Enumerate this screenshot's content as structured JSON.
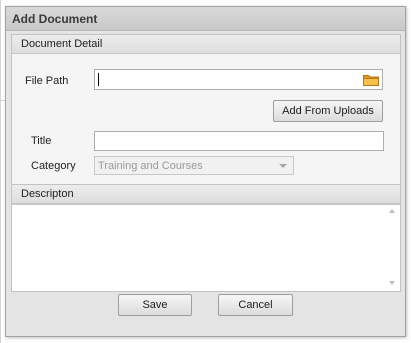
{
  "dialog": {
    "title": "Add Document"
  },
  "detail": {
    "header": "Document Detail",
    "file_path_label": "File Path",
    "file_path_value": "",
    "add_from_uploads_label": "Add From Uploads",
    "title_label": "Title",
    "title_value": "",
    "category_label": "Category",
    "category_value": "Training and Courses"
  },
  "description": {
    "header": "Descripton",
    "value": ""
  },
  "footer": {
    "save_label": "Save",
    "cancel_label": "Cancel"
  },
  "icons": {
    "folder": "folder-icon",
    "dropdown": "chevron-down-icon",
    "scroll_up": "scroll-up-icon",
    "scroll_down": "scroll-down-icon"
  },
  "colors": {
    "folder": "#f0a830",
    "dialog_bg": "#e4e4e4",
    "panel_bg": "#f5f5f5"
  }
}
